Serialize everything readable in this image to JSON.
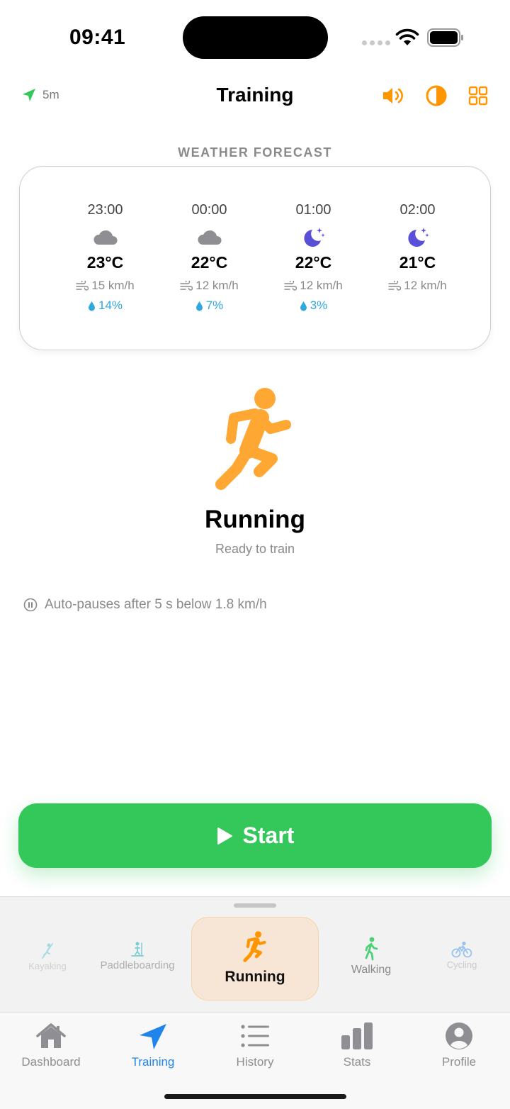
{
  "status_bar": {
    "time": "09:41"
  },
  "header": {
    "gps_label": "5m",
    "title": "Training",
    "icons": [
      "speaker-icon",
      "contrast-icon",
      "grid-icon"
    ]
  },
  "weather": {
    "section_label": "WEATHER FORECAST",
    "forecast": [
      {
        "hour": "23:00",
        "icon": "cloud-icon",
        "temp": "23°C",
        "wind": "15 km/h",
        "rain": "14%"
      },
      {
        "hour": "00:00",
        "icon": "cloud-icon",
        "temp": "22°C",
        "wind": "12 km/h",
        "rain": "7%"
      },
      {
        "hour": "01:00",
        "icon": "moon-stars-icon",
        "temp": "22°C",
        "wind": "12 km/h",
        "rain": "3%"
      },
      {
        "hour": "02:00",
        "icon": "moon-stars-icon",
        "temp": "21°C",
        "wind": "12 km/h",
        "rain": ""
      }
    ]
  },
  "activity": {
    "title": "Running",
    "subtitle": "Ready to train",
    "auto_pause": "Auto-pauses after 5 s below 1.8 km/h"
  },
  "start_label": "Start",
  "activities": [
    {
      "label": "Kayaking",
      "icon": "kayak-icon"
    },
    {
      "label": "Paddleboarding",
      "icon": "paddleboard-icon"
    },
    {
      "label": "Running",
      "icon": "running-icon",
      "selected": true
    },
    {
      "label": "Walking",
      "icon": "walking-icon"
    },
    {
      "label": "Cycling",
      "icon": "cycling-icon"
    }
  ],
  "tabs": [
    {
      "label": "Dashboard",
      "icon": "house-icon"
    },
    {
      "label": "Training",
      "icon": "location-arrow-icon",
      "active": true
    },
    {
      "label": "History",
      "icon": "list-icon"
    },
    {
      "label": "Stats",
      "icon": "bar-chart-icon"
    },
    {
      "label": "Profile",
      "icon": "person-icon"
    }
  ],
  "colors": {
    "accent_orange": "#ff9500",
    "start_green": "#34c759",
    "tab_active_blue": "#1f84ec",
    "gps_green": "#34c759",
    "rain_blue": "#2fa8de",
    "moon_purple": "#5a4fd8"
  }
}
